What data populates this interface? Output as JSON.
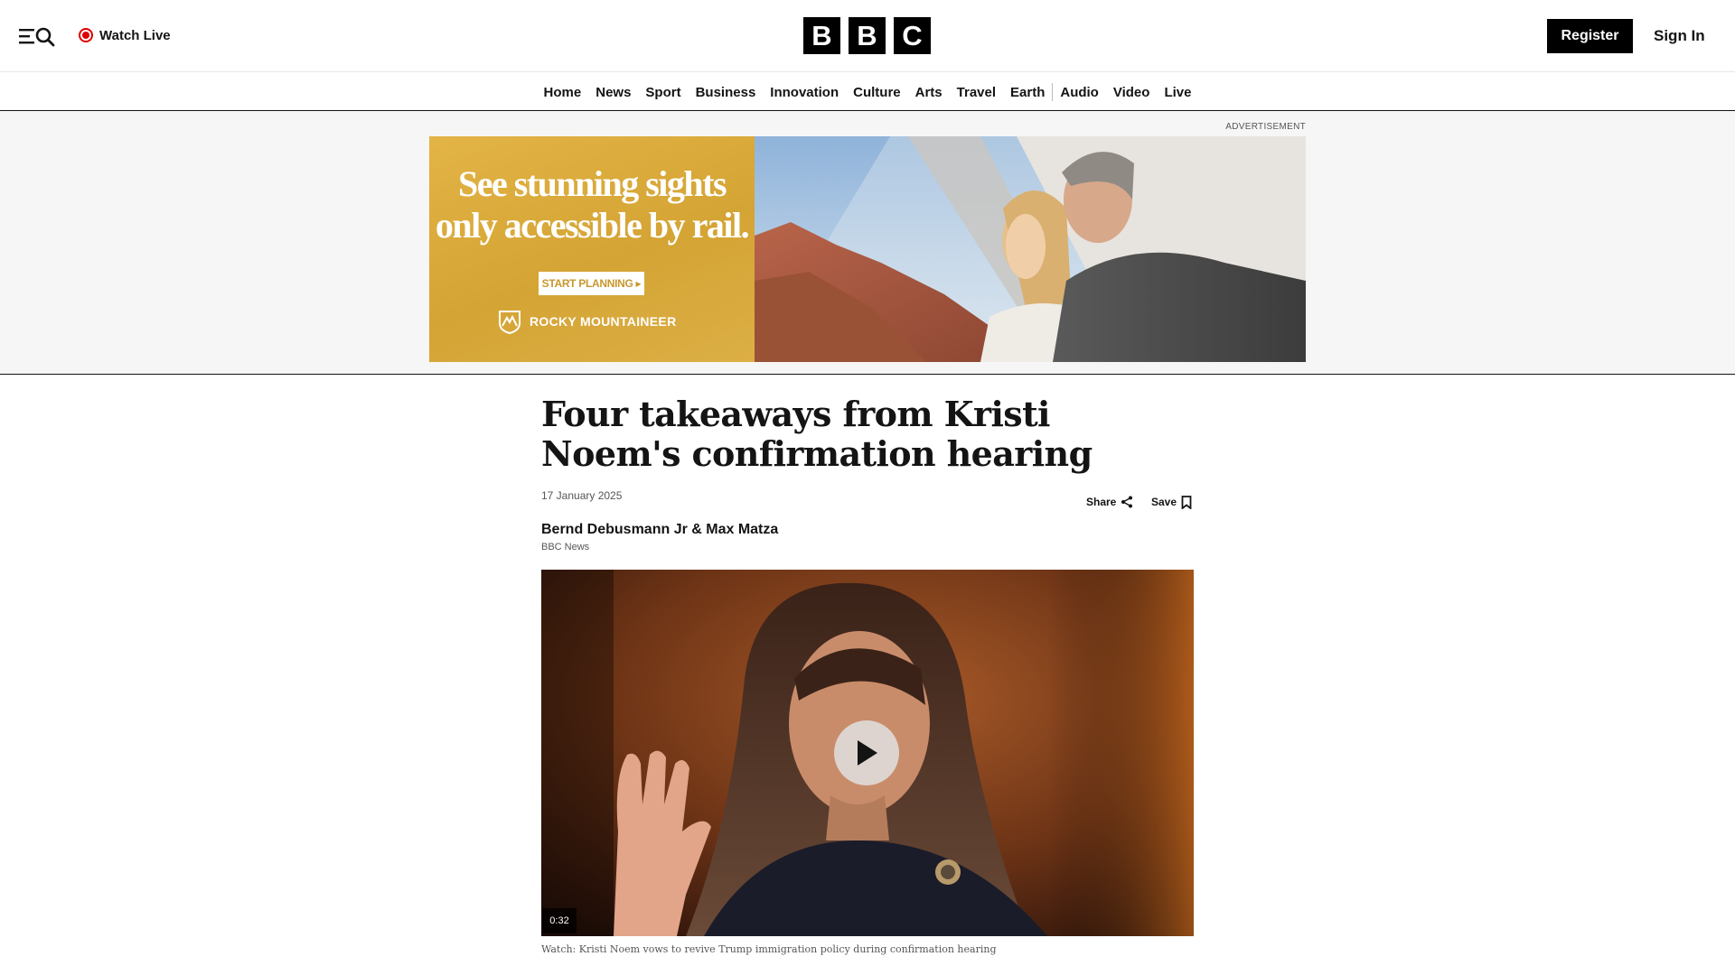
{
  "header": {
    "watch_live_label": "Watch Live",
    "logo_letters": [
      "B",
      "B",
      "C"
    ],
    "register_label": "Register",
    "signin_label": "Sign In"
  },
  "nav": {
    "items": [
      "Home",
      "News",
      "Sport",
      "Business",
      "Innovation",
      "Culture",
      "Arts",
      "Travel",
      "Earth",
      "Audio",
      "Video",
      "Live"
    ]
  },
  "ad": {
    "label": "ADVERTISEMENT",
    "headline_line1": "See stunning sights",
    "headline_line2": "only accessible by rail.",
    "cta": "START PLANNING",
    "brand": "ROCKY MOUNTAINEER",
    "brand_color": "#d9ab3f"
  },
  "article": {
    "headline": "Four takeaways from Kristi Noem's confirmation hearing",
    "date": "17 January 2025",
    "share_label": "Share",
    "save_label": "Save",
    "authors": "Bernd Debusmann Jr & Max Matza",
    "organization": "BBC News",
    "video": {
      "duration": "0:32",
      "caption": "Watch: Kristi Noem vows to revive Trump immigration policy during confirmation hearing"
    }
  },
  "colors": {
    "live_red": "#dd0000",
    "ink": "#141414",
    "muted": "#545658"
  }
}
